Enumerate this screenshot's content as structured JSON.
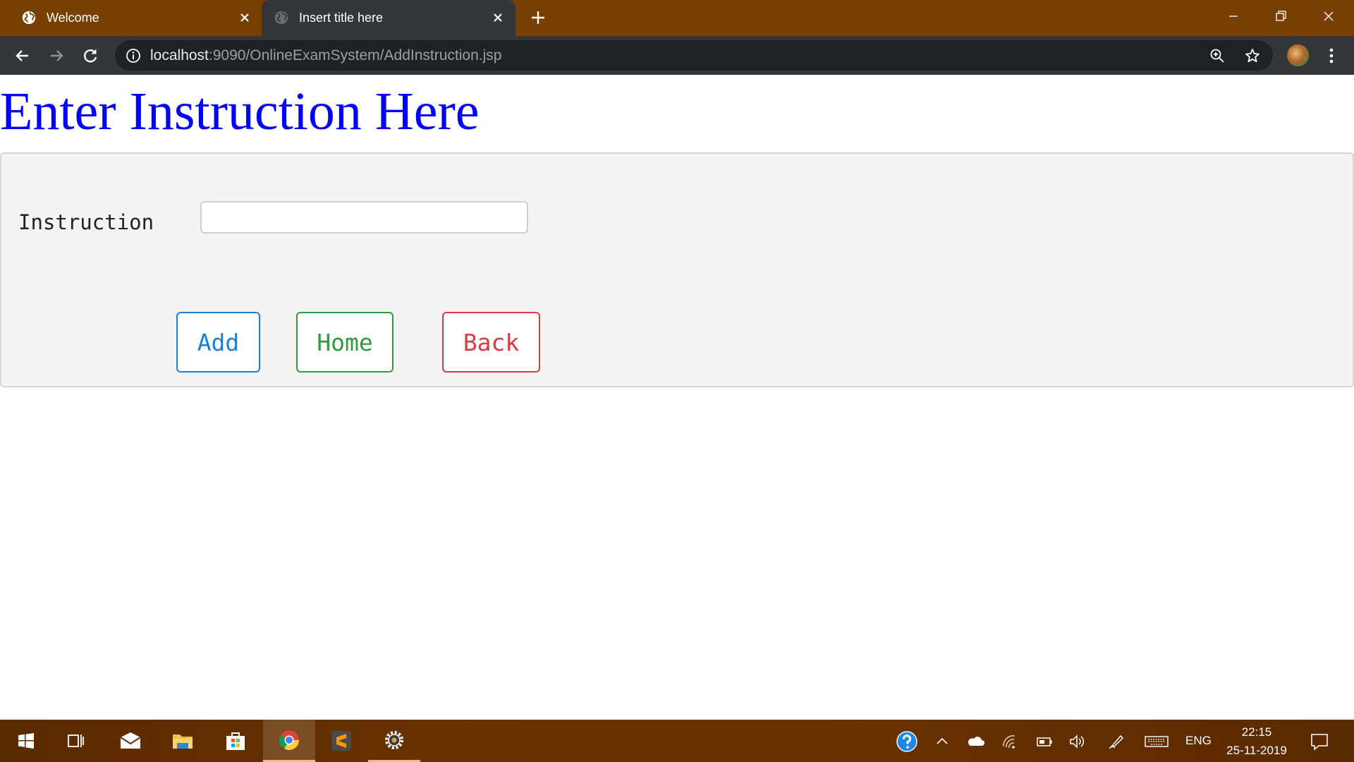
{
  "browser": {
    "tabs": [
      {
        "label": "Welcome"
      },
      {
        "label": "Insert title here"
      }
    ],
    "address": {
      "host": "localhost",
      "rest": ":9090/OnlineExamSystem/AddInstruction.jsp"
    }
  },
  "page": {
    "title": "Enter Instruction Here",
    "form": {
      "instruction_label": "Instruction",
      "instruction_value": "",
      "buttons": {
        "add": "Add",
        "home": "Home",
        "back": "Back"
      }
    }
  },
  "taskbar": {
    "language": "ENG",
    "time": "22:15",
    "date": "25-11-2019"
  },
  "colors": {
    "title": "#0000ff",
    "add": "#1a7fd7",
    "home": "#2e9b3f",
    "back": "#d93a44",
    "chrome_frame": "#773f00"
  }
}
